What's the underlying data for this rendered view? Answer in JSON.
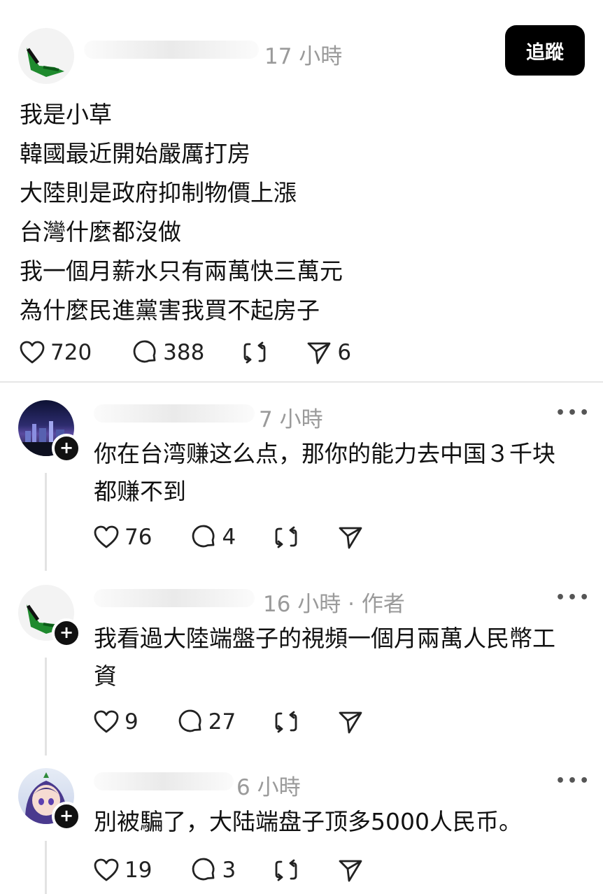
{
  "post": {
    "time": "17 小時",
    "follow_label": "追蹤",
    "lines": [
      "我是小草",
      "韓國最近開始嚴厲打房",
      "大陸則是政府抑制物價上漲",
      "台灣什麼都沒做",
      "我一個月薪水只有兩萬快三萬元",
      "為什麼民進黨害我買不起房子"
    ],
    "likes": "720",
    "comments": "388",
    "shares": "6"
  },
  "replies": [
    {
      "time": "7 小時",
      "text": "你在台湾赚这么点，那你的能力去中国３千块都赚不到",
      "likes": "76",
      "comments": "4"
    },
    {
      "time": "16 小時 · 作者",
      "text": "我看過大陸端盤子的視頻一個月兩萬人民幣工資",
      "likes": "9",
      "comments": "27"
    },
    {
      "time": "6 小時",
      "text": "別被騙了，大陆端盘子顶多5000人民币。",
      "likes": "19",
      "comments": "3"
    }
  ],
  "icons": [
    "heart-icon",
    "comment-icon",
    "repost-icon",
    "share-icon",
    "more-icon",
    "plus-icon"
  ],
  "colors": {
    "follow_bg": "#000000",
    "meta_gray": "#9a9a9a",
    "divider": "#e6e6e6"
  }
}
